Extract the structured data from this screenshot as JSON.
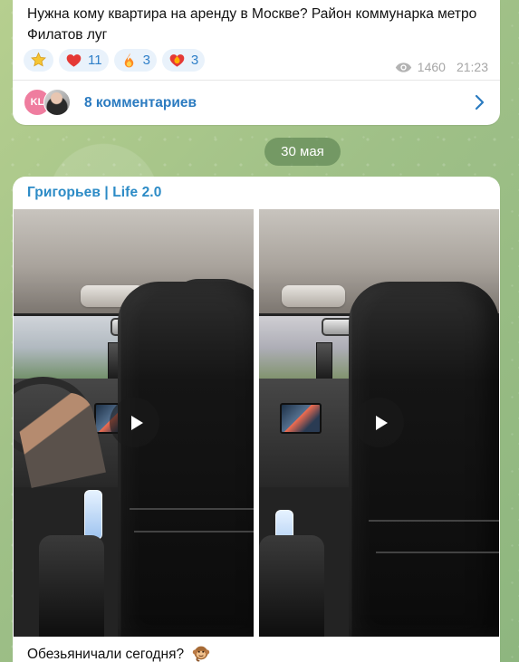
{
  "colors": {
    "link": "#2b7bc0",
    "channel": "#2c8bc6",
    "meta": "#a6a6a6",
    "reaction_bg": "#e9f2fb",
    "date_pill": "#6c925c"
  },
  "top_message": {
    "text": "Нужна кому квартира на аренду в Москве? Район коммунарка метро Филатов луг",
    "reactions": [
      {
        "icon": "star-icon",
        "count": ""
      },
      {
        "icon": "heart-icon",
        "count": "11"
      },
      {
        "icon": "fire-icon",
        "count": "3"
      },
      {
        "icon": "heart-fire-icon",
        "count": "3"
      }
    ],
    "views": "1460",
    "time": "21:23",
    "comments_label": "8 комментариев",
    "avatar_initials": "KL"
  },
  "date_separator": "30 мая",
  "post": {
    "channel_name": "Григорьев | Life 2.0",
    "caption": "Обезьяничали сегодня?",
    "caption_emoji": "monkey-icon",
    "videos": [
      {
        "icon": "play-icon"
      },
      {
        "icon": "play-icon"
      }
    ]
  }
}
